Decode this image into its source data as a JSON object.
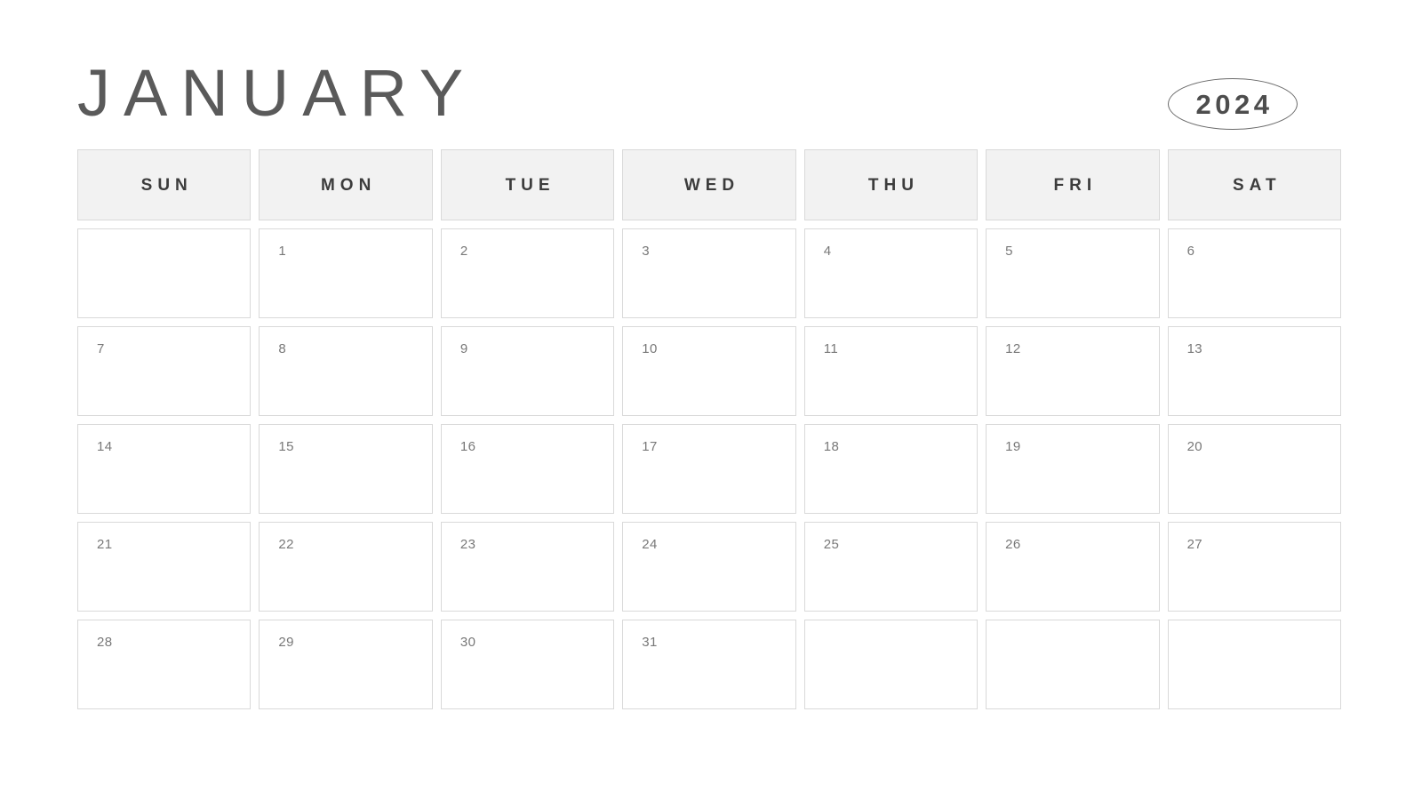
{
  "calendar": {
    "month_label": "JANUARY",
    "year_label": "2024",
    "weekdays": [
      {
        "label": "SUN"
      },
      {
        "label": "MON"
      },
      {
        "label": "TUE"
      },
      {
        "label": "WED"
      },
      {
        "label": "THU"
      },
      {
        "label": "FRI"
      },
      {
        "label": "SAT"
      }
    ],
    "weeks": [
      [
        {
          "day": ""
        },
        {
          "day": "1"
        },
        {
          "day": "2"
        },
        {
          "day": "3"
        },
        {
          "day": "4"
        },
        {
          "day": "5"
        },
        {
          "day": "6"
        }
      ],
      [
        {
          "day": "7"
        },
        {
          "day": "8"
        },
        {
          "day": "9"
        },
        {
          "day": "10"
        },
        {
          "day": "11"
        },
        {
          "day": "12"
        },
        {
          "day": "13"
        }
      ],
      [
        {
          "day": "14"
        },
        {
          "day": "15"
        },
        {
          "day": "16"
        },
        {
          "day": "17"
        },
        {
          "day": "18"
        },
        {
          "day": "19"
        },
        {
          "day": "20"
        }
      ],
      [
        {
          "day": "21"
        },
        {
          "day": "22"
        },
        {
          "day": "23"
        },
        {
          "day": "24"
        },
        {
          "day": "25"
        },
        {
          "day": "26"
        },
        {
          "day": "27"
        }
      ],
      [
        {
          "day": "28"
        },
        {
          "day": "29"
        },
        {
          "day": "30"
        },
        {
          "day": "31"
        },
        {
          "day": ""
        },
        {
          "day": ""
        },
        {
          "day": ""
        }
      ]
    ],
    "colors": {
      "page_background": "#ffffff",
      "title_text": "#5a5a5a",
      "year_text": "#4d4d4d",
      "year_badge_border": "#6a6a6a",
      "weekday_header_background": "#f2f2f2",
      "weekday_header_text": "#3c3c3c",
      "cell_border": "#d9d9d9",
      "cell_background": "#ffffff",
      "day_number_text": "#787878"
    }
  }
}
